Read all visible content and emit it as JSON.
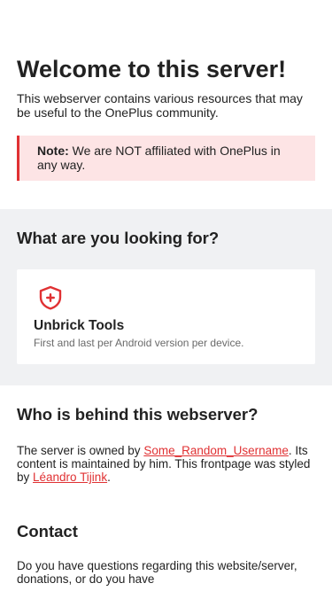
{
  "hero": {
    "title": "Welcome to this server!",
    "intro": "This webserver contains various resources that may be useful to the OnePlus community.",
    "note_label": "Note:",
    "note_text": " We are NOT affiliated with OnePlus in any way."
  },
  "looking": {
    "heading": "What are you looking for?",
    "card": {
      "icon": "shield-plus-icon",
      "title": "Unbrick Tools",
      "description": "First and last per Android version per device."
    }
  },
  "who": {
    "heading": "Who is behind this webserver?",
    "text_1": "The server is owned by ",
    "owner_link": "Some_Random_Username",
    "text_2": ". Its content is maintained by him. This frontpage was styled by ",
    "styler_link": "Léandro Tijink",
    "text_3": "."
  },
  "contact": {
    "heading": "Contact",
    "text": "Do you have questions regarding this website/server, donations, or do you have"
  },
  "colors": {
    "accent": "#e03133",
    "note_background": "#fde4e5",
    "section_background": "#f0f1f3"
  }
}
